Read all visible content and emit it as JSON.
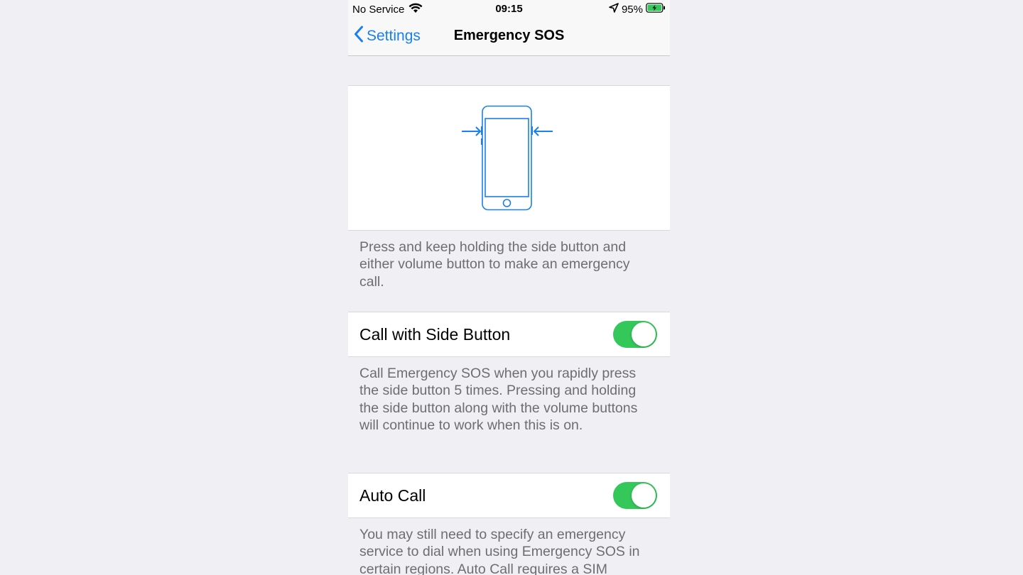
{
  "status_bar": {
    "carrier": "No Service",
    "time": "09:15",
    "battery": "95%",
    "icons": [
      "wifi-icon",
      "location-icon",
      "battery-charging-icon"
    ]
  },
  "nav": {
    "back_label": "Settings",
    "title": "Emergency SOS"
  },
  "illustration": {
    "icon": "phone-side-buttons-icon"
  },
  "descriptions": {
    "intro": "Press and keep holding the side button and either volume button to make an emergency call.",
    "side_button": "Call Emergency SOS when you rapidly press the side button 5 times. Pressing and holding the side button along with the volume buttons will continue to work when this is on.",
    "auto_call": "You may still need to specify an emergency service to dial when using Emergency SOS in certain regions. Auto Call requires a SIM"
  },
  "settings": {
    "call_with_side_button": {
      "label": "Call with Side Button",
      "enabled": true
    },
    "auto_call": {
      "label": "Auto Call",
      "enabled": true
    }
  },
  "colors": {
    "accent": "#1a7ff0",
    "toggle_on": "#34c759",
    "background": "#efeff4",
    "secondary_text": "#6d6d72"
  }
}
